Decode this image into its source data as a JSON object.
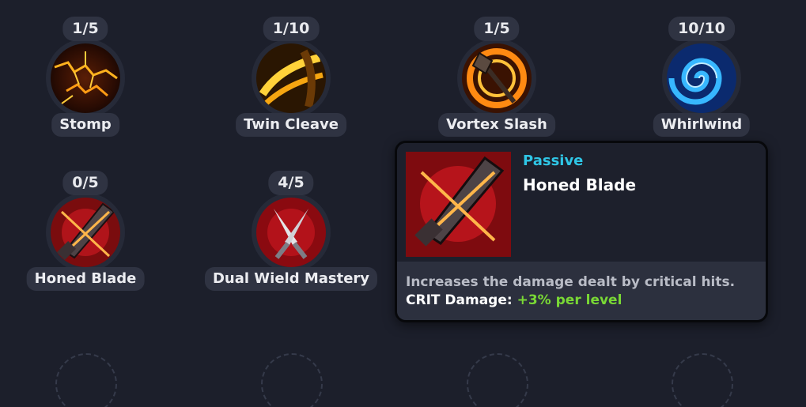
{
  "skills": [
    {
      "name": "Stomp",
      "level": "1/5",
      "icon": "stomp-icon"
    },
    {
      "name": "Twin Cleave",
      "level": "1/10",
      "icon": "twin-cleave-icon"
    },
    {
      "name": "Vortex Slash",
      "level": "1/5",
      "icon": "vortex-slash-icon"
    },
    {
      "name": "Whirlwind",
      "level": "10/10",
      "icon": "whirlwind-icon"
    },
    {
      "name": "Honed Blade",
      "level": "0/5",
      "icon": "honed-blade-icon"
    },
    {
      "name": "Dual Wield Mastery",
      "level": "4/5",
      "icon": "dual-wield-mastery-icon"
    }
  ],
  "tooltip": {
    "type": "Passive",
    "title": "Honed Blade",
    "description": "Increases the damage dealt by critical hits.",
    "stat_label": "CRIT Damage:",
    "stat_value": "+3% per level",
    "icon": "honed-blade-icon"
  },
  "colors": {
    "background": "#1c1f2b",
    "passive": "#2fc6e6",
    "stat_value": "#79d835"
  }
}
